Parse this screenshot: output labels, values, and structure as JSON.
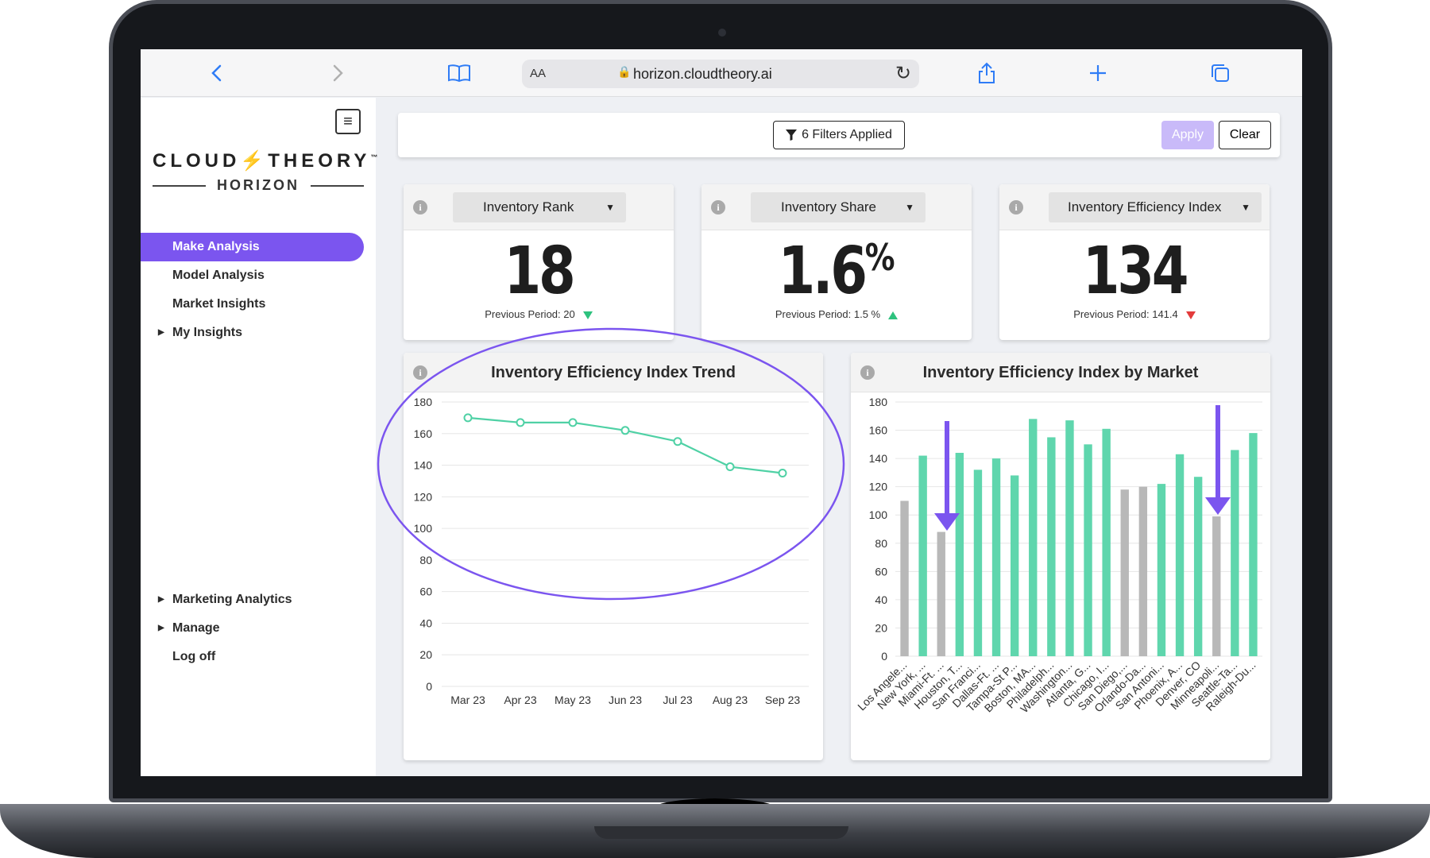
{
  "browser": {
    "text_size_label": "AA",
    "url": "horizon.cloudtheory.ai"
  },
  "brand": {
    "name_left": "CLOUD",
    "name_right": "THEORY",
    "trademark": "™",
    "product": "HORIZON"
  },
  "nav": {
    "items": [
      {
        "label": "Make Analysis",
        "active": true,
        "expandable": false
      },
      {
        "label": "Model Analysis",
        "active": false,
        "expandable": false
      },
      {
        "label": "Market Insights",
        "active": false,
        "expandable": false
      },
      {
        "label": "My Insights",
        "active": false,
        "expandable": true
      }
    ],
    "bottom_items": [
      {
        "label": "Marketing Analytics",
        "expandable": true
      },
      {
        "label": "Manage",
        "expandable": true
      },
      {
        "label": "Log off",
        "expandable": false
      }
    ]
  },
  "filters": {
    "button_label": "6 Filters Applied",
    "apply_label": "Apply",
    "clear_label": "Clear"
  },
  "kpis": [
    {
      "metric": "Inventory Rank",
      "value": "18",
      "unit": "",
      "previous": "Previous Period: 20",
      "trend": "down",
      "trend_color": "#2ec27e"
    },
    {
      "metric": "Inventory Share",
      "value": "1.6",
      "unit": "%",
      "previous": "Previous Period: 1.5 %",
      "trend": "up",
      "trend_color": "#2ec27e"
    },
    {
      "metric": "Inventory Efficiency Index",
      "value": "134",
      "unit": "",
      "previous": "Previous Period: 141.4",
      "trend": "down",
      "trend_color": "#e33b3b"
    }
  ],
  "colors": {
    "accent": "#7b55ef",
    "line": "#4fd1a5",
    "bar_green": "#5fd6ad",
    "bar_gray": "#b8b8b8"
  },
  "chart_data": [
    {
      "type": "line",
      "title": "Inventory Efficiency Index Trend",
      "categories": [
        "Mar 23",
        "Apr 23",
        "May 23",
        "Jun 23",
        "Jul 23",
        "Aug 23",
        "Sep 23"
      ],
      "values": [
        170,
        167,
        167,
        162,
        155,
        139,
        135
      ],
      "ylim": [
        0,
        180
      ],
      "yticks": [
        0,
        20,
        40,
        60,
        80,
        100,
        120,
        140,
        160,
        180
      ],
      "grid": true
    },
    {
      "type": "bar",
      "title": "Inventory Efficiency Index by Market",
      "categories": [
        "Los Angele...",
        "New York, ...",
        "Miami-Ft. ...",
        "Houston, T...",
        "San Franci...",
        "Dallas-Ft. ...",
        "Tampa-St P...",
        "Boston, MA...",
        "Philadelph...",
        "Washington...",
        "Atlanta, G...",
        "Chicago, I...",
        "San Diego,...",
        "Orlando-Da...",
        "San Antoni...",
        "Phoenix, A...",
        "Denver, CO",
        "Minneapoli...",
        "Seattle-Ta...",
        "Raleigh-Du..."
      ],
      "values": [
        110,
        142,
        88,
        144,
        132,
        140,
        128,
        168,
        155,
        167,
        150,
        161,
        118,
        120,
        122,
        143,
        127,
        99,
        146,
        158
      ],
      "highlight": [
        "gray",
        "green",
        "gray",
        "green",
        "green",
        "green",
        "green",
        "green",
        "green",
        "green",
        "green",
        "green",
        "gray",
        "gray",
        "green",
        "green",
        "green",
        "gray",
        "green",
        "green"
      ],
      "ylim": [
        0,
        180
      ],
      "yticks": [
        0,
        20,
        40,
        60,
        80,
        100,
        120,
        140,
        160,
        180
      ],
      "grid": true
    }
  ]
}
